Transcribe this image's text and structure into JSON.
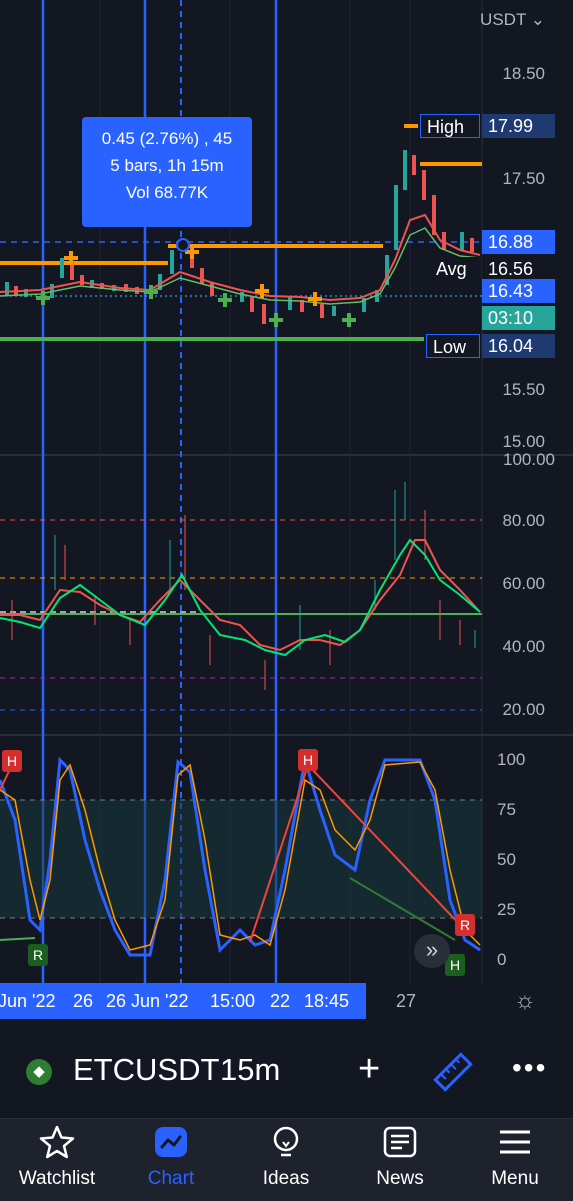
{
  "chart": {
    "currency": "USDT",
    "price_axis": [
      "18.50",
      "17.50",
      "15.50",
      "15.00"
    ],
    "price_tags": {
      "high_label": "High",
      "high_value": "17.99",
      "current": "16.88",
      "avg_label": "Avg",
      "avg_value": "16.56",
      "last": "16.43",
      "countdown": "03:10",
      "low_label": "Low",
      "low_value": "16.04"
    },
    "measure_tooltip": {
      "line1": "0.45 (2.76%) , 45",
      "line2": "5 bars, 1h 15m",
      "line3": "Vol 68.77K"
    },
    "rsi_axis": [
      "100.00",
      "80.00",
      "60.00",
      "40.00",
      "20.00"
    ],
    "stoch_axis": [
      "100",
      "75",
      "50",
      "25",
      "0"
    ],
    "time_axis": {
      "labels": [
        "Jun '22",
        "26",
        "26 Jun '22",
        "15:00",
        "22",
        "18:45",
        "27"
      ]
    },
    "markers": {
      "high": "H",
      "reversal": "R"
    },
    "colors": {
      "background": "#131722",
      "selection": "#2962ff",
      "bull": "#26a69a",
      "bear": "#ef5350",
      "orange": "#ff9800",
      "green_line": "#4caf50"
    }
  },
  "toolbar": {
    "symbol": "ETCUSDT",
    "interval": "15m",
    "add_icon": "plus-icon",
    "ruler_icon": "ruler-icon",
    "more_icon": "more-icon"
  },
  "nav": {
    "items": [
      {
        "label": "Watchlist",
        "icon": "star-icon"
      },
      {
        "label": "Chart",
        "icon": "chart-icon"
      },
      {
        "label": "Ideas",
        "icon": "bulb-icon"
      },
      {
        "label": "News",
        "icon": "news-icon"
      },
      {
        "label": "Menu",
        "icon": "menu-icon"
      }
    ]
  }
}
